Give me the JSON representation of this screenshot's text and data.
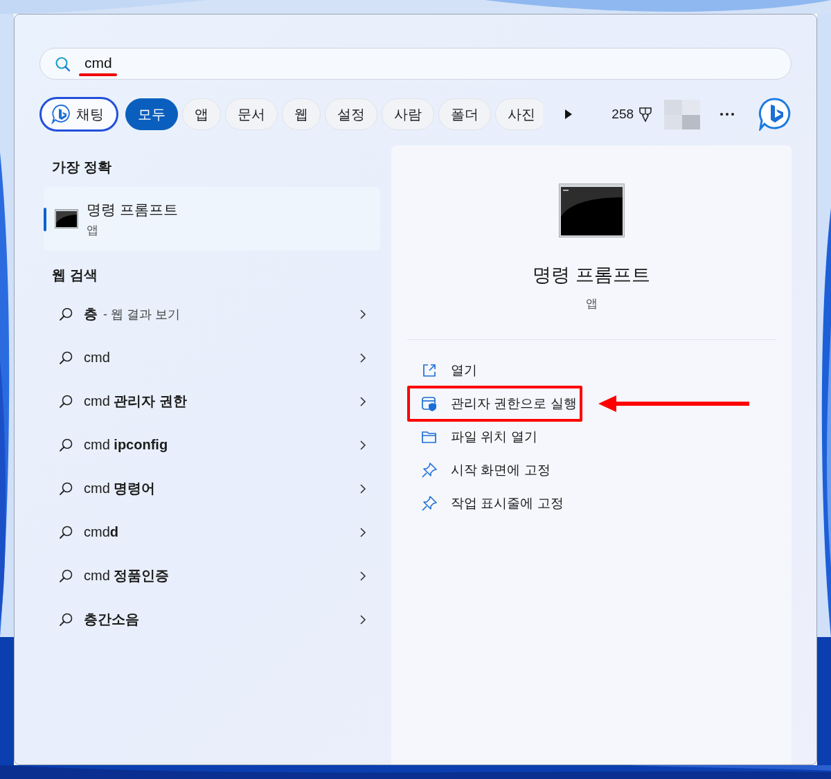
{
  "search": {
    "value": "cmd",
    "underlined": true
  },
  "filters": [
    {
      "label": "채팅",
      "kind": "chat",
      "selected": false
    },
    {
      "label": "모두",
      "kind": "tab",
      "selected": true
    },
    {
      "label": "앱",
      "kind": "tab",
      "selected": false
    },
    {
      "label": "문서",
      "kind": "tab",
      "selected": false
    },
    {
      "label": "웹",
      "kind": "tab",
      "selected": false
    },
    {
      "label": "설정",
      "kind": "tab",
      "selected": false
    },
    {
      "label": "사람",
      "kind": "tab",
      "selected": false
    },
    {
      "label": "폴더",
      "kind": "tab",
      "selected": false
    },
    {
      "label": "사진",
      "kind": "tab",
      "selected": false
    }
  ],
  "points": "258",
  "best_match": {
    "heading": "가장 정확",
    "title": "명령 프롬프트",
    "subtitle": "앱",
    "selected": true
  },
  "web_search": {
    "heading": "웹 검색",
    "items": [
      {
        "query": "**층**",
        "suffix": "- 웹 결과 보기"
      },
      {
        "query": "cmd"
      },
      {
        "query": "cmd **관리자 권한**"
      },
      {
        "query": "cmd **ipconfig**"
      },
      {
        "query": "cmd **명령어**"
      },
      {
        "query": "cmd**d**"
      },
      {
        "query": "cmd **정품인증**"
      },
      {
        "query": "**층간소음**"
      }
    ]
  },
  "detail": {
    "title": "명령 프롬프트",
    "subtitle": "앱",
    "actions": [
      {
        "label": "열기",
        "kind": "open",
        "highlighted": false
      },
      {
        "label": "관리자 권한으로 실행",
        "kind": "admin",
        "highlighted": true
      },
      {
        "label": "파일 위치 열기",
        "kind": "folder",
        "highlighted": false
      },
      {
        "label": "시작 화면에 고정",
        "kind": "pin",
        "highlighted": false
      },
      {
        "label": "작업 표시줄에 고정",
        "kind": "pin",
        "highlighted": false
      }
    ]
  }
}
